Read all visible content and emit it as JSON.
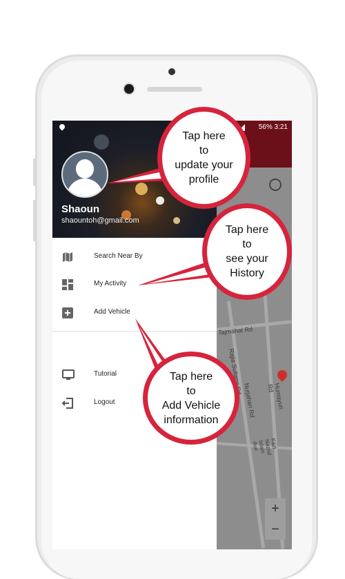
{
  "status_bar": {
    "battery": "56%",
    "time": "3:21"
  },
  "profile": {
    "name": "Shaoun",
    "email": "shaountoh@gmail.com"
  },
  "menu": [
    {
      "label": "Search Near By",
      "icon": "map-icon"
    },
    {
      "label": "My Activity",
      "icon": "dashboard-icon"
    },
    {
      "label": "Add Vehicle",
      "icon": "add-box-icon"
    },
    {
      "label": "Tutorial",
      "icon": "monitor-icon"
    },
    {
      "label": "Logout",
      "icon": "logout-icon"
    }
  ],
  "map": {
    "labels": [
      "Tajmahal Rd",
      "Rajia Sultana Rd",
      "Nurjahan Rd",
      "Humayun Rd",
      "Kazi Nazrul Islam Ave"
    ],
    "zoom_in": "+",
    "zoom_out": "−"
  },
  "callouts": {
    "profile": "Tap  here\nto\nupdate your\nprofile",
    "history": "Tap  here\nto\nsee your\nHistory",
    "vehicle": "Tap  here\nto\nAdd Vehicle\ninformation"
  },
  "colors": {
    "accent": "#d6243c",
    "appbar": "#6b1019"
  }
}
